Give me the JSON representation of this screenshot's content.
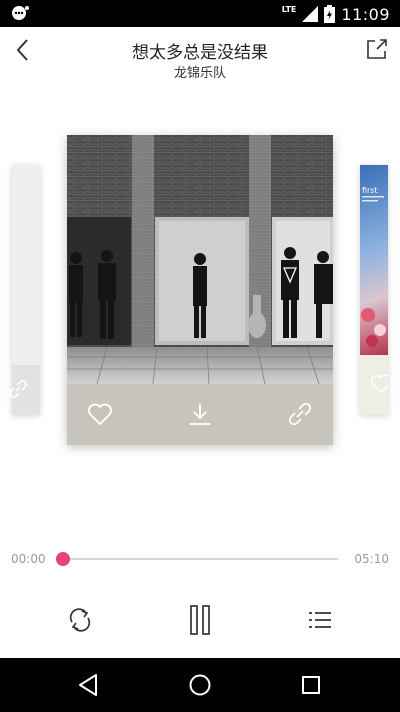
{
  "status_bar": {
    "network": "LTE",
    "time": "11:09",
    "icons": [
      "notification-icon",
      "signal-icon",
      "battery-icon"
    ]
  },
  "header": {
    "title": "想太多总是没结果",
    "artist": "龙锦乐队"
  },
  "playback": {
    "current_time": "00:00",
    "total_time": "05:10",
    "progress": 0.0
  },
  "card_actions": [
    "heart-icon",
    "download-icon",
    "link-icon"
  ],
  "controls": [
    "repeat-icon",
    "pause-icon",
    "playlist-icon"
  ],
  "nav": [
    "back-triangle-icon",
    "home-circle-icon",
    "recents-square-icon"
  ],
  "colors": {
    "accent": "#ec407a",
    "status_bar": "#000000",
    "nav_bar": "#000000",
    "card_action_bar": "#c7c4bc"
  }
}
